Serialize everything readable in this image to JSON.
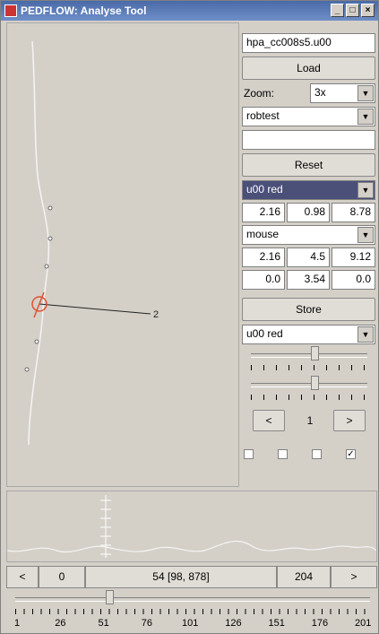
{
  "window": {
    "title": "PEDFLOW: Analyse Tool",
    "min": "_",
    "max": "□",
    "close": "×"
  },
  "panel": {
    "filename": "hpa_cc008s5.u00",
    "load_label": "Load",
    "zoom_label": "Zoom:",
    "zoom_value": "3x",
    "dataset": "robtest",
    "empty_field": "",
    "reset_label": "Reset",
    "track_select": "u00 red",
    "coords1": [
      "2.16",
      "0.98",
      "8.78"
    ],
    "mode_select": "mouse",
    "coords2": [
      "2.16",
      "4.5",
      "9.12"
    ],
    "coords3": [
      "0.0",
      "3.54",
      "0.0"
    ],
    "store_label": "Store",
    "track_select2": "u00 red",
    "slider1_value": 0.55,
    "slider2_value": 0.55,
    "prev_label": "<",
    "page_value": "1",
    "next_label": ">",
    "checkboxes": [
      false,
      false,
      false,
      true
    ],
    "check_mark": "✓"
  },
  "trajectory": {
    "marker_label": "2"
  },
  "bottom": {
    "prev_label": "<",
    "start_value": "0",
    "frame_info": "54 [98, 878]",
    "end_value": "204",
    "next_label": ">",
    "frame_slider_value": 54,
    "frame_min": 1,
    "frame_max": 204,
    "ticks": [
      "1",
      "26",
      "51",
      "76",
      "101",
      "126",
      "151",
      "176",
      "201"
    ]
  },
  "colors": {
    "accent": "#4a5078",
    "marker": "#e05030"
  }
}
